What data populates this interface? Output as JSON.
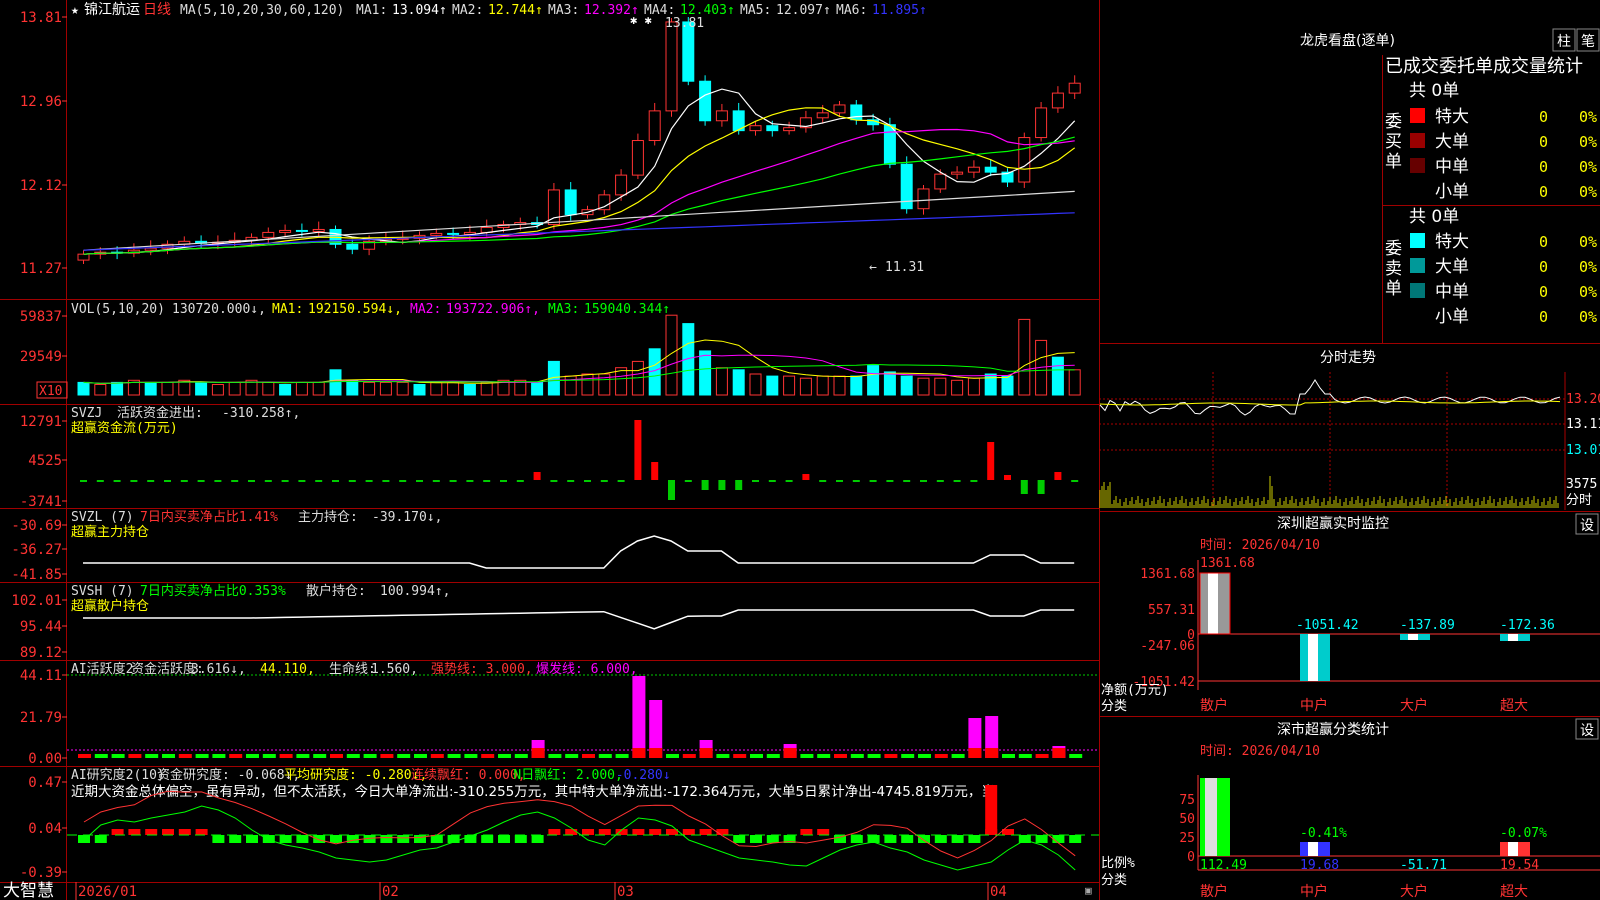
{
  "stock": {
    "name": "锦江航运",
    "period": "日线"
  },
  "price_pane": {
    "ma_header": "MA(5,10,20,30,60,120)",
    "ma_values": [
      {
        "label": "MA1:",
        "value": "13.094↑",
        "color": "#ffffff"
      },
      {
        "label": "MA2:",
        "value": "12.744↑",
        "color": "#ffff00"
      },
      {
        "label": "MA3:",
        "value": "12.392↑",
        "color": "#ff00ff"
      },
      {
        "label": "MA4:",
        "value": "12.403↑",
        "color": "#00ff00"
      },
      {
        "label": "MA5:",
        "value": "12.097↑",
        "color": "#dddddd"
      },
      {
        "label": "MA6:",
        "value": "11.895↑",
        "color": "#3333ff"
      }
    ],
    "y_ticks": [
      "13.81",
      "12.96",
      "12.12",
      "11.27"
    ],
    "high_label": "13.81",
    "low_label": "11.31"
  },
  "vol_pane": {
    "header": "VOL(5,10,20)",
    "value": "130720.000↓,",
    "mas": [
      {
        "label": "MA1:",
        "value": "192150.594↓,",
        "color": "#ffff00"
      },
      {
        "label": "MA2:",
        "value": "193722.906↑,",
        "color": "#ff00ff"
      },
      {
        "label": "MA3:",
        "value": "159040.344↑",
        "color": "#00ff00"
      }
    ],
    "y_ticks": [
      "59837",
      "29549"
    ],
    "unit": "X10"
  },
  "svzj_pane": {
    "code": "SVZJ",
    "label": "活跃资金进出:",
    "value": "-310.258↑,",
    "sub": "超赢资金流(万元)",
    "y_ticks": [
      "12791",
      "4525",
      "-3741"
    ]
  },
  "svzl_pane": {
    "code": "SVZL (7)",
    "ratio": "7日内买卖净占比1.41%",
    "label": "主力持仓:",
    "value": "-39.170↓,",
    "sub": "超赢主力持仓",
    "y_ticks": [
      "-30.69",
      "-36.27",
      "-41.85"
    ]
  },
  "svsh_pane": {
    "code": "SVSH (7)",
    "ratio": "7日内买卖净占比0.353%",
    "label": "散户持仓:",
    "value": "100.994↑,",
    "sub": "超赢散户持仓",
    "y_ticks": [
      "102.01",
      "95.44",
      "89.12"
    ]
  },
  "ai_active_pane": {
    "items": [
      {
        "text": "AI活跃度2",
        "color": "#dddddd"
      },
      {
        "text": "资金活跃度:",
        "color": "#dddddd"
      },
      {
        "text": "3.616↓,",
        "color": "#dddddd"
      },
      {
        "text": "44.110,",
        "color": "#ffff00"
      },
      {
        "text": "生命线:",
        "color": "#dddddd"
      },
      {
        "text": "1.560,",
        "color": "#dddddd"
      },
      {
        "text": "强势线: 3.000,",
        "color": "#ff3333"
      },
      {
        "text": "爆发线: 6.000,",
        "color": "#ff00ff"
      }
    ],
    "y_ticks": [
      "44.11",
      "21.79",
      "0.00"
    ]
  },
  "ai_research_pane": {
    "items": [
      {
        "text": "AI研究度2(10)",
        "color": "#dddddd"
      },
      {
        "text": "资金研究度: -0.068↓,",
        "color": "#dddddd"
      },
      {
        "text": "平均研究度: -0.280↓,",
        "color": "#ffff00"
      },
      {
        "text": "连续飘红: 0.000,",
        "color": "#ff3333"
      },
      {
        "text": "N日飘红: 2.000,",
        "color": "#00ff00"
      },
      {
        "text": "-0.280↓",
        "color": "#3333ff"
      }
    ],
    "summary": "近期大资金总体偏空，虽有异动，但不太活跃，今日大单净流出:-310.255万元，其中特大单净流出:-172.364万元，大单5日累计净出-4745.819万元，当",
    "y_ticks": [
      "0.47",
      "0.04",
      "-0.39"
    ]
  },
  "x_axis": {
    "labels": [
      "2026/01",
      "02",
      "03",
      "04"
    ]
  },
  "brand": "大智慧",
  "right_panel": {
    "dragon": {
      "title": "龙虎看盘(逐单)",
      "btn1": "柱",
      "btn2": "笔",
      "subtitle": "已成交委托单成交量统计",
      "buy_label": "委买单",
      "sell_label": "委卖单",
      "buy_total": "共 0单",
      "sell_total": "共 0单",
      "buy_rows": [
        {
          "name": "特大",
          "count": "0",
          "pct": "0%",
          "color": "#ff0000"
        },
        {
          "name": "大单",
          "count": "0",
          "pct": "0%",
          "color": "#990000"
        },
        {
          "name": "中单",
          "count": "0",
          "pct": "0%",
          "color": "#660000"
        },
        {
          "name": "小单",
          "count": "0",
          "pct": "0%",
          "color": ""
        }
      ],
      "sell_rows": [
        {
          "name": "特大",
          "count": "0",
          "pct": "0%",
          "color": "#00ffff"
        },
        {
          "name": "大单",
          "count": "0",
          "pct": "0%",
          "color": "#009999"
        },
        {
          "name": "中单",
          "count": "0",
          "pct": "0%",
          "color": "#007777"
        },
        {
          "name": "小单",
          "count": "0",
          "pct": "0%",
          "color": ""
        }
      ]
    },
    "intraday": {
      "title": "分时走势",
      "y_labels": [
        "13.20",
        "13.11",
        "13.01"
      ],
      "vol_label": "3575",
      "vol_unit": "分时"
    },
    "sz_monitor": {
      "title": "深圳超赢实时监控",
      "btn": "设",
      "time": "时间: 2026/04/10",
      "y_ticks": [
        "1361.68",
        "557.31",
        "0",
        "-247.06",
        "-1051.42"
      ],
      "unit_label": "净额(万元)",
      "cat_label": "分类",
      "cats": [
        "散户",
        "中户",
        "大户",
        "超大"
      ],
      "values": [
        "1361.68",
        "-1051.42",
        "-137.89",
        "-172.36"
      ]
    },
    "sz_classify": {
      "title": "深市超赢分类统计",
      "btn": "设",
      "time": "时间: 2026/04/10",
      "y_ticks": [
        "75",
        "50",
        "25",
        "0"
      ],
      "ratio_label": "比例%",
      "cat_label": "分类",
      "cats": [
        "散户",
        "中户",
        "大户",
        "超大"
      ],
      "top_values": [
        "",
        "-0.41%",
        "",
        "-0.07%"
      ],
      "bottom_values": [
        "112.49",
        "19.68",
        "-51.71",
        "19.54"
      ]
    }
  }
}
